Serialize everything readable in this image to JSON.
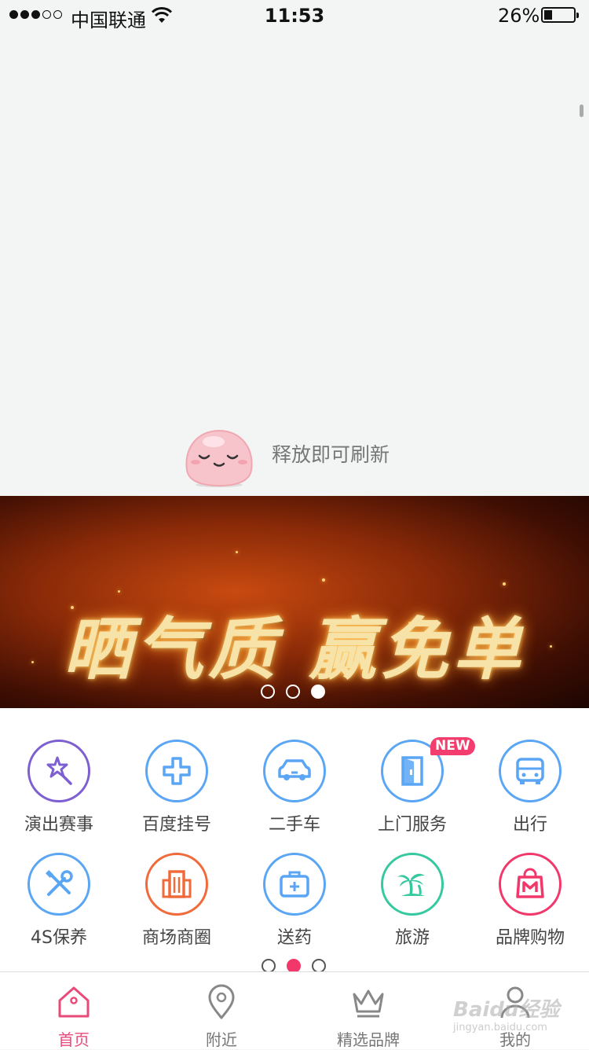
{
  "status_bar": {
    "carrier": "中国联通",
    "time": "11:53",
    "battery": "26%",
    "battery_level": 0.26,
    "signal_bars_filled": 3,
    "signal_bars_total": 5
  },
  "refresh": {
    "text": "释放即可刷新"
  },
  "banner": {
    "headline": "晒气质 赢免单",
    "page_count": 3,
    "active_page": 3
  },
  "services": {
    "items": [
      {
        "label": "演出赛事",
        "icon": "magic-wand-star-icon",
        "color": "#7d5fd1"
      },
      {
        "label": "百度挂号",
        "icon": "plus-cross-icon",
        "color": "#5aa6f5"
      },
      {
        "label": "二手车",
        "icon": "car-icon",
        "color": "#5aa6f5"
      },
      {
        "label": "上门服务",
        "icon": "door-icon",
        "color": "#5aa6f5",
        "badge": "NEW"
      },
      {
        "label": "出行",
        "icon": "bus-icon",
        "color": "#5aa6f5"
      },
      {
        "label": "4S保养",
        "icon": "tools-icon",
        "color": "#5aa6f5"
      },
      {
        "label": "商场商圈",
        "icon": "building-icon",
        "color": "#f06a3a"
      },
      {
        "label": "送药",
        "icon": "medicine-kit-icon",
        "color": "#5aa6f5"
      },
      {
        "label": "旅游",
        "icon": "palm-tree-icon",
        "color": "#36c9a0"
      },
      {
        "label": "品牌购物",
        "icon": "shopping-bag-icon",
        "color": "#f2386a"
      }
    ],
    "page_count": 3,
    "active_page": 2
  },
  "tabbar": {
    "tabs": [
      {
        "label": "首页",
        "icon": "home-icon",
        "active": true
      },
      {
        "label": "附近",
        "icon": "location-pin-icon",
        "active": false
      },
      {
        "label": "精选品牌",
        "icon": "crown-icon",
        "active": false
      },
      {
        "label": "我的",
        "icon": "user-icon",
        "active": false
      }
    ]
  },
  "watermark": {
    "brand": "Baidu经验",
    "url": "jingyan.baidu.com"
  },
  "colors": {
    "accent": "#f2386a",
    "blue": "#5aa6f5",
    "tab_active": "#e84b7a"
  }
}
